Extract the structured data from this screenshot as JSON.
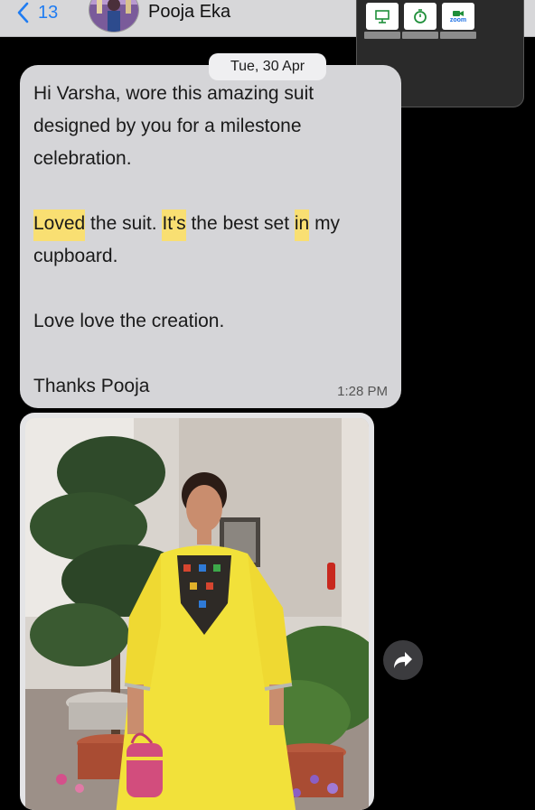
{
  "header": {
    "back_count": "13",
    "contact_name": "Pooja Eka"
  },
  "pip": {
    "apps": [
      {
        "icon": "presentation-icon",
        "caption": ""
      },
      {
        "icon": "stopwatch-icon",
        "caption": ""
      },
      {
        "icon": "zoom-icon",
        "caption": "zoom"
      }
    ]
  },
  "chat": {
    "date_label": "Tue, 30 Apr",
    "message": {
      "line1": "Hi Varsha, wore this amazing suit designed by you for a milestone celebration.",
      "line2_parts": [
        "Loved",
        " the suit. ",
        "It's",
        " the best set ",
        "in",
        " my cupboard."
      ],
      "line3": "Love love the creation.",
      "line4": "Thanks Pooja",
      "time": "1:28 PM"
    }
  },
  "colors": {
    "header_bg": "#d7d7d9",
    "bubble_bg": "#d5d5d8",
    "highlight": "#f9df72",
    "link_blue": "#1f7cf2",
    "dress_yellow": "#f2e13a"
  }
}
